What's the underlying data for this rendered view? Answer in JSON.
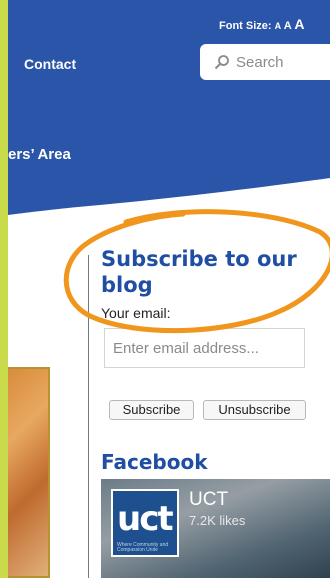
{
  "header": {
    "font_size_label": "Font Size:",
    "font_size_small": "A",
    "font_size_medium": "A",
    "font_size_large": "A",
    "nav_contact": "Contact",
    "search_placeholder": "Search",
    "members_area": "ers’ Area"
  },
  "subscribe": {
    "title": "Subscribe to our blog",
    "email_label": "Your email:",
    "email_placeholder": "Enter email address...",
    "subscribe_button": "Subscribe",
    "unsubscribe_button": "Unsubscribe"
  },
  "facebook": {
    "title": "Facebook",
    "page_name": "UCT",
    "likes": "7.2K likes",
    "logo_letters": "uct",
    "logo_tagline": "Where Community and Compassion Unite"
  },
  "colors": {
    "header_blue": "#2b55a8",
    "accent_green": "#c9db4a",
    "title_blue": "#1f4ea3",
    "annotation_orange": "#f0961c"
  },
  "icons": {
    "search": "search-icon"
  }
}
